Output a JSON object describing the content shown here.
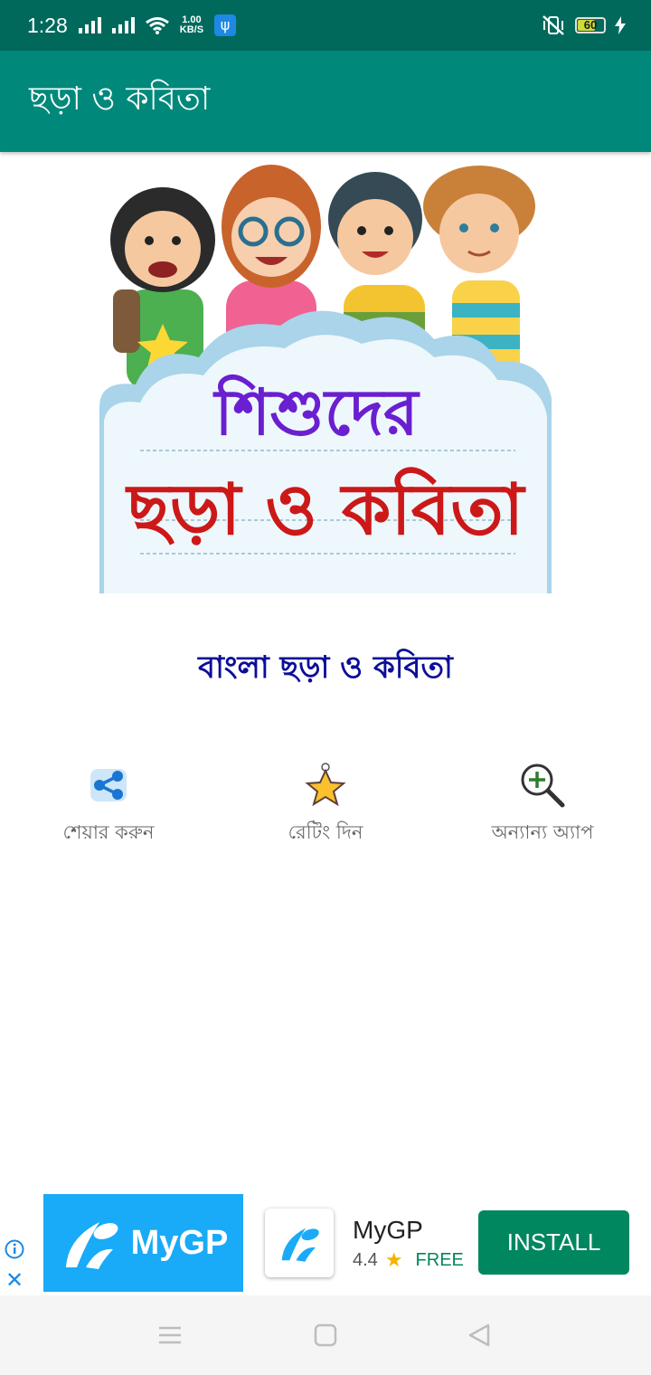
{
  "status_bar": {
    "time": "1:28",
    "net_speed_value": "1.00",
    "net_speed_unit": "KB/S",
    "battery": "60"
  },
  "app_bar": {
    "title": "ছড়া ও কবিতা"
  },
  "banner": {
    "line1": "শিশুদের",
    "line2": "ছড়া ও কবিতা"
  },
  "subtitle": "বাংলা ছড়া ও কবিতা",
  "actions": [
    {
      "label": "শেয়ার করুন",
      "icon": "share-icon"
    },
    {
      "label": "রেটিং দিন",
      "icon": "star-rating-icon"
    },
    {
      "label": "অন্যান্য অ্যাপ",
      "icon": "magnifier-plus-icon"
    }
  ],
  "ad": {
    "brand_text": "MyGP",
    "app_name": "MyGP",
    "rating": "4.4",
    "price": "FREE",
    "install_label": "INSTALL",
    "colors": {
      "brand_bg": "#19aaf8",
      "install_bg": "#01875f"
    }
  },
  "colors": {
    "status_bar": "#00695c",
    "app_bar": "#00897b",
    "subtitle": "#0d0d9a",
    "banner_line1": "#6a1fd0",
    "banner_line2": "#cc1818"
  }
}
